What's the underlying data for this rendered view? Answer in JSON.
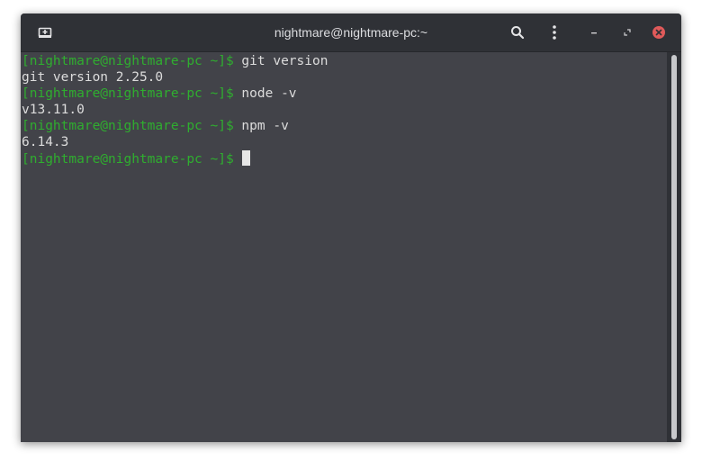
{
  "window": {
    "title": "nightmare@nightmare-pc:~"
  },
  "titlebar": {
    "icons": {
      "new_tab": "new-tab-icon",
      "search": "search-icon",
      "menu": "kebab-menu-icon",
      "minimize": "minimize-icon",
      "maximize": "maximize-icon",
      "close": "close-icon"
    },
    "close_color": "#e05a5a"
  },
  "colors": {
    "background": "#424349",
    "titlebar": "#2f3136",
    "prompt": "#2fae2f",
    "text": "#dcdcdc"
  },
  "terminal": {
    "lines": [
      {
        "prompt": "[nightmare@nightmare-pc ~]$",
        "command": " git version"
      },
      {
        "output": "git version 2.25.0"
      },
      {
        "prompt": "[nightmare@nightmare-pc ~]$",
        "command": " node -v"
      },
      {
        "output": "v13.11.0"
      },
      {
        "prompt": "[nightmare@nightmare-pc ~]$",
        "command": " npm -v"
      },
      {
        "output": "6.14.3"
      },
      {
        "prompt": "[nightmare@nightmare-pc ~]$",
        "command": " "
      }
    ]
  }
}
